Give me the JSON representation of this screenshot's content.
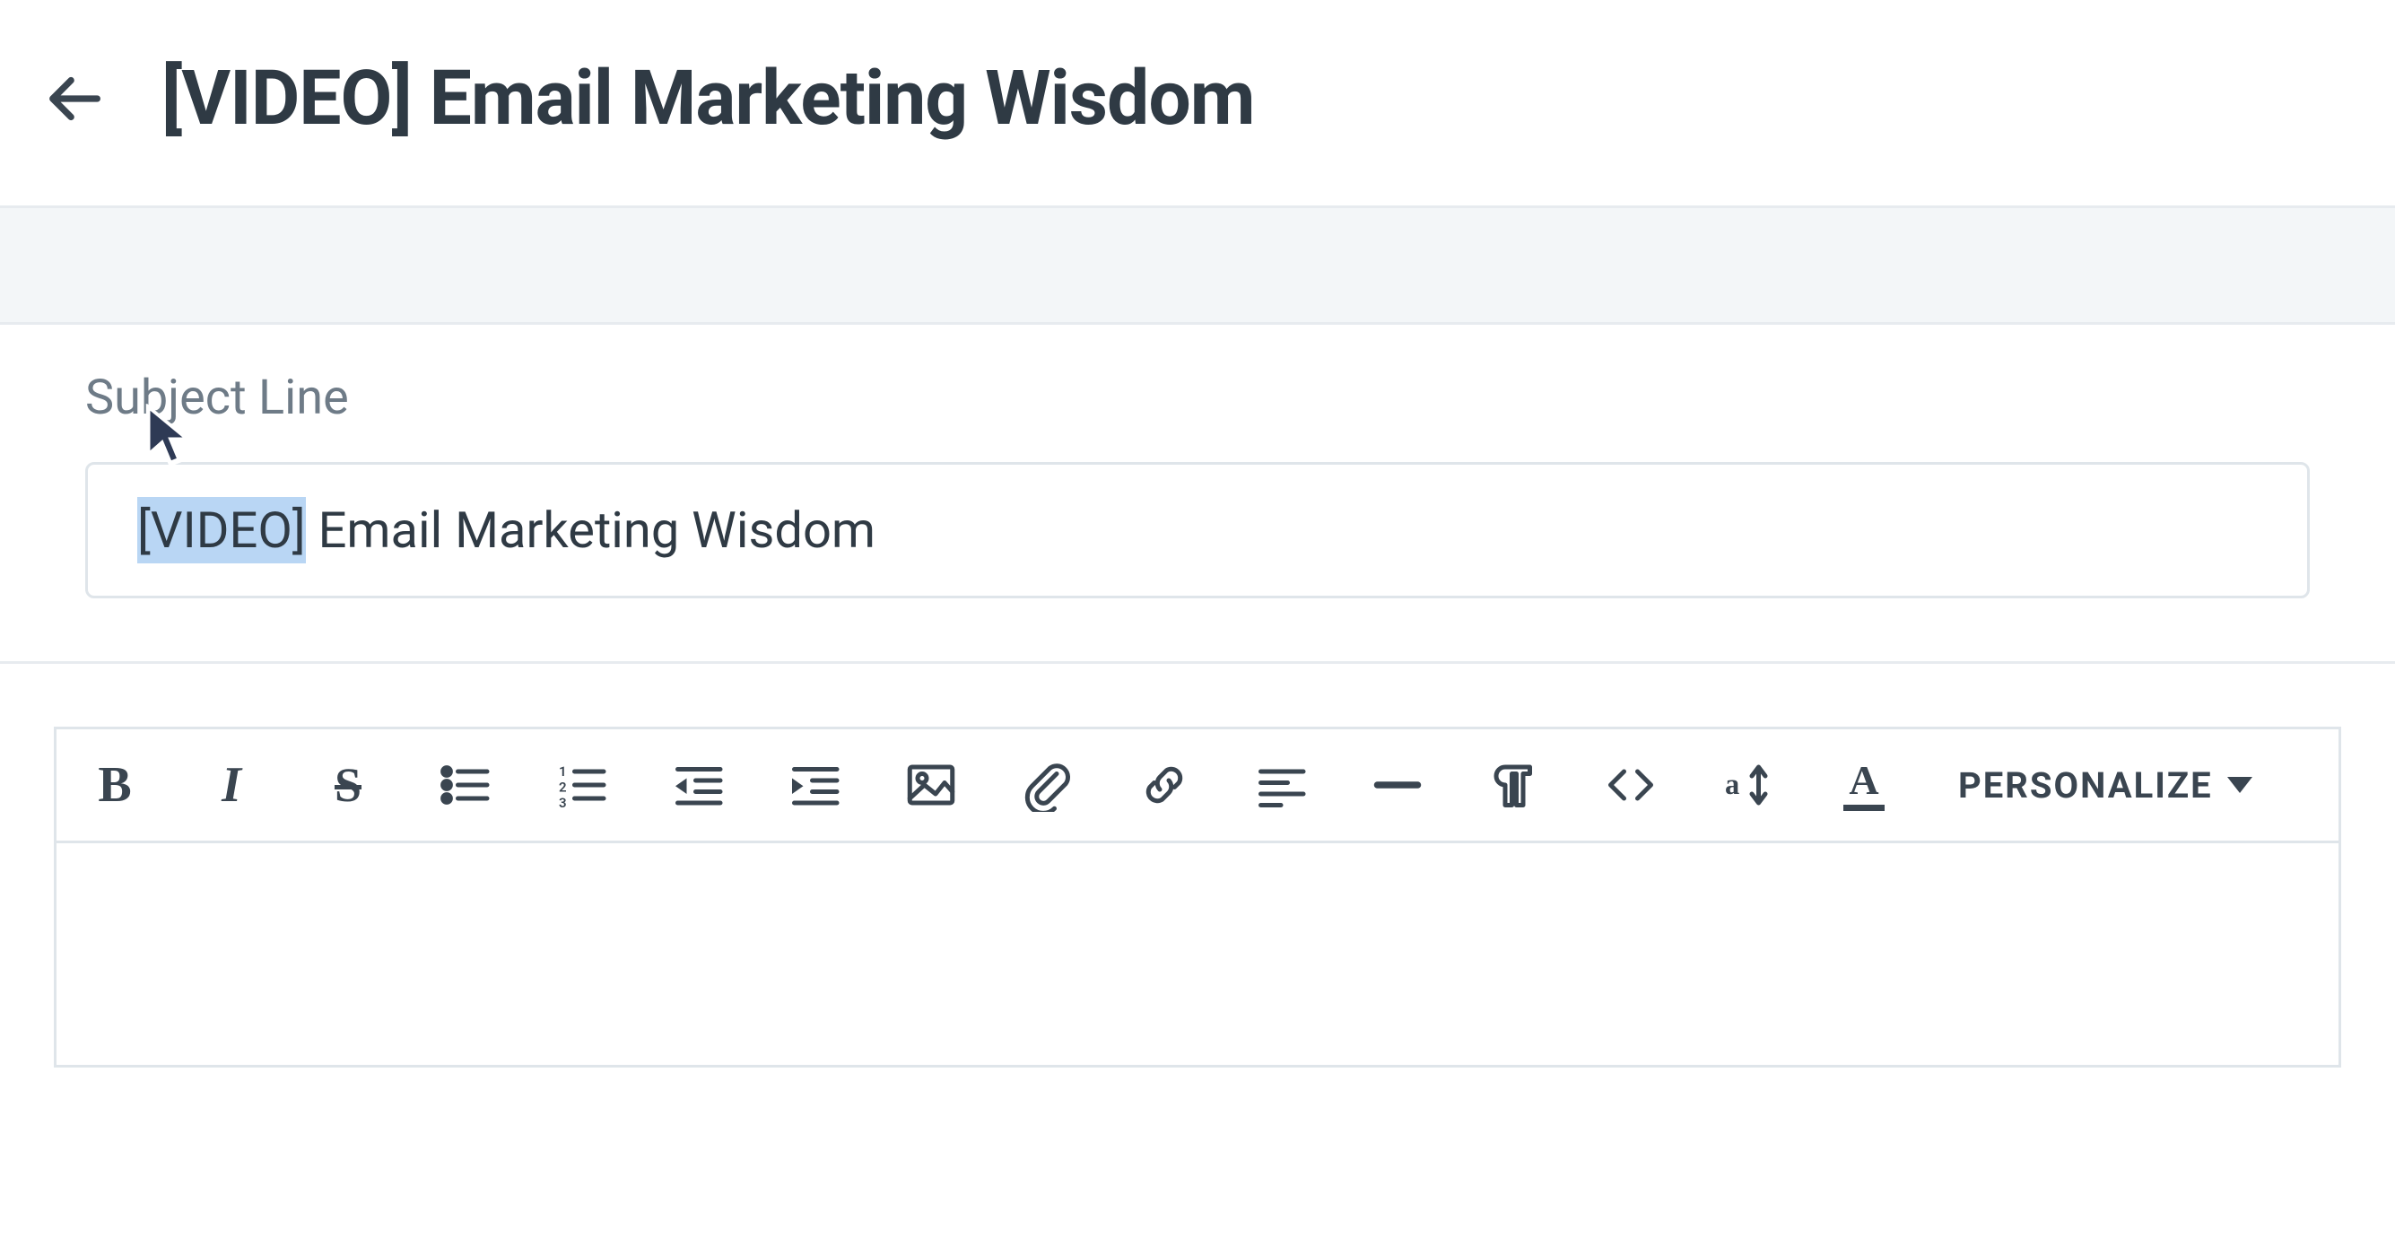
{
  "header": {
    "title": "[VIDEO] Email Marketing Wisdom"
  },
  "subject": {
    "label": "Subject Line",
    "value_highlighted": "[VIDEO]",
    "value_rest": " Email Marketing Wisdom"
  },
  "toolbar": {
    "bold_glyph": "B",
    "italic_glyph": "I",
    "strike_glyph": "S",
    "text_color_glyph": "A",
    "personalize_label": "PERSONALIZE"
  }
}
